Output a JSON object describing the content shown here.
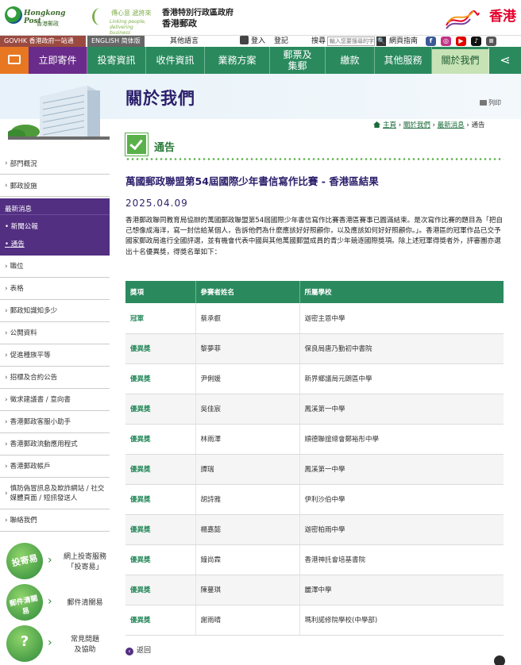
{
  "header": {
    "logo_en": "Hongkong Post",
    "logo_zh": "香港郵政",
    "slogan_zh": "傳心意 遞將來",
    "slogan_en": "Linking people, delivering business",
    "govt_line1": "香港特別行政區政府",
    "govt_line2": "香港郵政",
    "brand_hk": "香港"
  },
  "utility": {
    "govhk": "GOVHK 香港政府一站通",
    "langs": "ENGLISH  简体版",
    "other_lang": "其他語言",
    "login": "登入",
    "register": "登記",
    "search_label": "搜尋",
    "search_placeholder": "輸入您要搜尋的字串",
    "search_btn": "🔍",
    "sitemap": "網頁指南",
    "social": [
      {
        "icon": "facebook-icon",
        "glyph": "f",
        "color": "#3b5998"
      },
      {
        "icon": "instagram-icon",
        "glyph": "◎",
        "color": "#c13584"
      },
      {
        "icon": "youtube-icon",
        "glyph": "▶",
        "color": "#e00000"
      },
      {
        "icon": "tiktok-icon",
        "glyph": "♪",
        "color": "#111111"
      },
      {
        "icon": "menu-icon",
        "glyph": "≡",
        "color": "#555555"
      }
    ]
  },
  "nav": {
    "items": [
      {
        "label": "立即寄件"
      },
      {
        "label": "投寄資訊"
      },
      {
        "label": "收件資訊"
      },
      {
        "label": "業務方案"
      },
      {
        "label": "郵票及\n集郵"
      },
      {
        "label": "繳款"
      },
      {
        "label": "其他服務"
      },
      {
        "label": "關於我們"
      }
    ],
    "share_glyph": "⋖"
  },
  "page": {
    "title": "關於我們",
    "print": "列印",
    "breadcrumb": {
      "home": "主頁",
      "about": "關於我們",
      "news": "最新消息",
      "current": "通告"
    },
    "section_title": "通告"
  },
  "sidebar": {
    "items_top": [
      "部門概況",
      "郵政設施"
    ],
    "active": {
      "title": "最新消息",
      "subs": [
        "新聞公報",
        "通告"
      ]
    },
    "items_bottom": [
      "職位",
      "表格",
      "郵政知識知多少",
      "公開資料",
      "促進種族平等",
      "招標及合約公告",
      "徵求建議書 / 意向書",
      "香港郵政客服小助手",
      "香港郵政流動應用程式",
      "香港郵政帳戶",
      "慎防偽冒訊息及欺詐網站 / 社交媒體頁面 / 短訊發送人",
      "聯絡我們"
    ],
    "quick": [
      {
        "badge": "投寄易",
        "label": "網上投寄服務\n「投寄易」"
      },
      {
        "badge": "郵件清關易",
        "label": "郵件清關易"
      },
      {
        "badge": "?",
        "label": "常見問題\n及協助"
      }
    ]
  },
  "article": {
    "title": "萬國郵政聯盟第54屆國際少年書信寫作比賽 - 香港區結果",
    "date": "2025.04.09",
    "body": "香港郵政聯同教育局協辦的萬國郵政聯盟第54屆國際少年書信寫作比賽香港區賽事已圓滿結束。是次寫作比賽的題目為「把自己想像成海洋，寫一封信給某個人，告訴他們為什麼應該好好照顧你，以及應該如何好好照顧你。」。香港區的冠軍作品已交予國家郵政局進行全國評選，並有機會代表中國與其他萬國郵盟成員的青少年競逐國際獎項。除上述冠軍得獎者外，評審團亦選出十名優異獎，得獎名單如下："
  },
  "results": {
    "headers": [
      "獎項",
      "參賽者姓名",
      "所屬學校"
    ],
    "rows": [
      [
        "冠軍",
        "蔡承叡",
        "迦密主恩中學"
      ],
      [
        "優異獎",
        "黎夢菲",
        "保良局唐乃勤初中書院"
      ],
      [
        "優異獎",
        "尹俐媛",
        "新界鄉議局元朗區中學"
      ],
      [
        "優異獎",
        "吳佳宸",
        "鳳溪第一中學"
      ],
      [
        "優異獎",
        "林雨澤",
        "順德聯誼總會鄭裕彤中學"
      ],
      [
        "優異獎",
        "譚瑞",
        "鳳溪第一中學"
      ],
      [
        "優異獎",
        "胡詩雅",
        "伊利沙伯中學"
      ],
      [
        "優異獎",
        "楊嘉懿",
        "迦密柏雨中學"
      ],
      [
        "優異獎",
        "鐘尚霖",
        "香港神託會培基書院"
      ],
      [
        "優異獎",
        "陳蔓琪",
        "麗澤中學"
      ],
      [
        "優異獎",
        "謝雨晴",
        "瑪利諾修院學校(中學部)"
      ]
    ]
  },
  "footer": {
    "back": "返回"
  },
  "colors": {
    "green": "#2a8a5e",
    "purple": "#532f82",
    "orange": "#e87722",
    "navy_title": "#2b1f6b"
  }
}
